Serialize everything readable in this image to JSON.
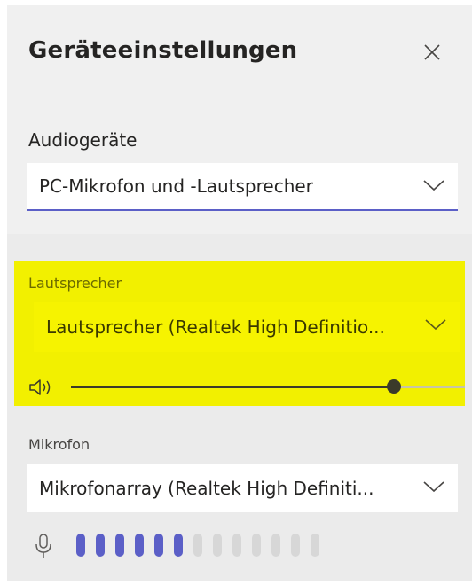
{
  "dialog": {
    "title": "Geräteeinstellungen",
    "close_icon": "close-icon"
  },
  "audio": {
    "label": "Audiogeräte",
    "selected": "PC-Mikrofon und -Lautsprecher"
  },
  "speaker": {
    "label": "Lautsprecher",
    "selected": "Lautsprecher (Realtek High Definitio...",
    "volume_percent": 82,
    "highlight_color": "#f2f000"
  },
  "microphone": {
    "label": "Mikrofon",
    "selected": "Mikrofonarray (Realtek High Definiti...",
    "level_bars_total": 13,
    "level_bars_active": 6
  },
  "colors": {
    "accent": "#5b5fc7",
    "text": "#252423"
  }
}
